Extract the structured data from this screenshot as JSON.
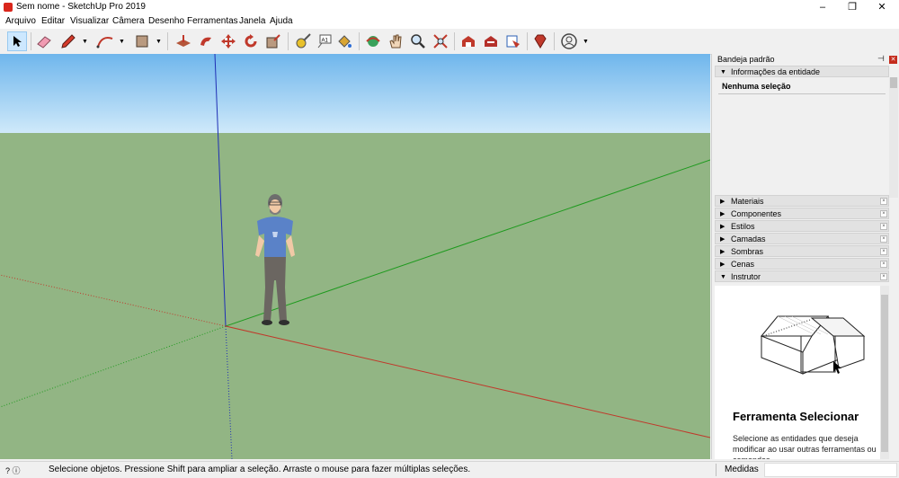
{
  "window": {
    "title": "Sem nome - SketchUp Pro 2019",
    "min_glyph": "–",
    "restore_glyph": "❐",
    "close_glyph": "✕"
  },
  "menu": [
    "Arquivo",
    "Editar",
    "Visualizar",
    "Câmera",
    "Desenho",
    "Ferramentas",
    "Janela",
    "Ajuda"
  ],
  "toolbar": {
    "tools": [
      "select",
      "eraser",
      "pencil",
      "arc",
      "rectangle",
      "push-pull",
      "follow-me",
      "move",
      "rotate",
      "scale",
      "tape-measure",
      "text",
      "paint-bucket",
      "orbit",
      "pan",
      "zoom",
      "zoom-extents",
      "3d-warehouse",
      "extension-warehouse",
      "layout",
      "ruby",
      "account"
    ],
    "active_tool": "select"
  },
  "tray": {
    "title": "Bandeja padrão",
    "pin_glyph": "⊣",
    "panels": [
      {
        "label": "Informações da entidade",
        "expanded": true
      },
      {
        "label": "Materiais",
        "expanded": false
      },
      {
        "label": "Componentes",
        "expanded": false
      },
      {
        "label": "Estilos",
        "expanded": false
      },
      {
        "label": "Camadas",
        "expanded": false
      },
      {
        "label": "Sombras",
        "expanded": false
      },
      {
        "label": "Cenas",
        "expanded": false
      },
      {
        "label": "Instrutor",
        "expanded": true
      }
    ],
    "entity_info": "Nenhuma seleção",
    "instructor": {
      "title": "Ferramenta Selecionar",
      "text": "Selecione as entidades que deseja modificar ao usar outras ferramentas ou comandos."
    }
  },
  "status": {
    "icons": "? ⓘ",
    "text": "Selecione objetos. Pressione Shift para ampliar a seleção. Arraste o mouse para fazer múltiplas seleções.",
    "measure_label": "Medidas",
    "measure_value": ""
  },
  "colors": {
    "sky_top": "#6fb6ec",
    "ground": "#92b584",
    "axis_red": "#c0392b",
    "axis_green": "#1e9a1e",
    "axis_blue": "#1f2fb5",
    "accent": "#cde8ff"
  }
}
